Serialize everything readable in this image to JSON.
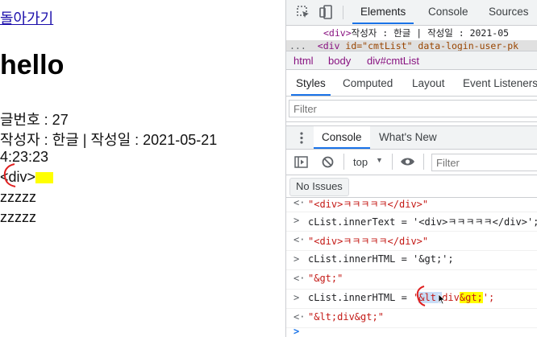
{
  "page": {
    "back_link": "돌아가기",
    "title": "hello",
    "post_number": "글번호 : 27",
    "author_line": "작성자 : 한글 | 작성일 : 2021-05-21",
    "time": "4:23:23",
    "comment_text": "<div>",
    "lines": [
      "zzzzz",
      "zzzzz"
    ]
  },
  "devtools": {
    "tabs": [
      "Elements",
      "Console",
      "Sources"
    ],
    "active_tab": "Elements",
    "elements_lines": [
      {
        "tag_open": "<div>",
        "text": "작성자 : 한글 | 작성일 : 2021-05"
      },
      {
        "prefix": "...",
        "tag": "<div",
        "attr": " id=\"cmtList\"",
        "rest": " data-login-user-pk"
      }
    ],
    "breadcrumb": [
      "html",
      "body",
      "div#cmtList"
    ],
    "styles_tabs": [
      "Styles",
      "Computed",
      "Layout",
      "Event Listeners"
    ],
    "filter_placeholder": "Filter",
    "drawer_tabs": [
      "Console",
      "What's New"
    ],
    "context": "top",
    "console_filter_placeholder": "Filter",
    "issues": "No Issues",
    "console_rows": [
      {
        "kind": "result",
        "symbol": "<·",
        "text": "\"<div>ㅋㅋㅋㅋㅋ</div>\""
      },
      {
        "kind": "input",
        "symbol": ">",
        "text": "cList.innerText = '<div>ㅋㅋㅋㅋㅋ</div>';"
      },
      {
        "kind": "result",
        "symbol": "<·",
        "text": "\"<div>ㅋㅋㅋㅋㅋ</div>\""
      },
      {
        "kind": "input",
        "symbol": ">",
        "text": "cList.innerHTML = '&gt;';"
      },
      {
        "kind": "result",
        "symbol": "<·",
        "text": "\"&gt;\""
      },
      {
        "kind": "input",
        "symbol": ">",
        "code": "cList.innerHTML = ",
        "str_open": "'",
        "sel": "&lt;",
        "mid": "div",
        "hl": "&gt;",
        "str_close": "';"
      },
      {
        "kind": "result",
        "symbol": "<·",
        "text": "\"&lt;div&gt;\""
      },
      {
        "kind": "prompt",
        "symbol": ">",
        "text": ""
      }
    ],
    "colors": {
      "accent": "#1a73e8",
      "string": "#c41a16",
      "tag": "#881280",
      "highlight": "#ffff00"
    }
  }
}
